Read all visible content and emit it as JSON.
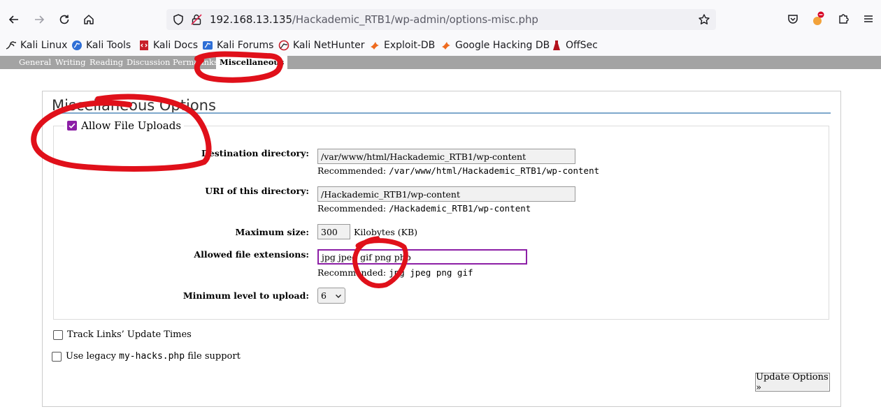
{
  "browser": {
    "url_host": "192.168.13.135",
    "url_path": "/Hackademic_RTB1/wp-admin/options-misc.php",
    "bookmarks": [
      {
        "label": "Kali Linux",
        "icon": "kali-dragon-icon"
      },
      {
        "label": "Kali Tools",
        "icon": "kali-tools-icon"
      },
      {
        "label": "Kali Docs",
        "icon": "kali-docs-icon"
      },
      {
        "label": "Kali Forums",
        "icon": "kali-forums-icon"
      },
      {
        "label": "Kali NetHunter",
        "icon": "nethunter-icon"
      },
      {
        "label": "Exploit-DB",
        "icon": "exploit-db-icon"
      },
      {
        "label": "Google Hacking DB",
        "icon": "ghdb-icon"
      },
      {
        "label": "OffSec",
        "icon": "offsec-icon"
      }
    ]
  },
  "submenu": {
    "items": [
      "General",
      "Writing",
      "Reading",
      "Discussion",
      "Permalinks",
      "Miscellaneous"
    ],
    "current": "Miscellaneous"
  },
  "page": {
    "title": "Miscellaneous Options",
    "allow_uploads_label": "Allow File Uploads",
    "allow_uploads_checked": true,
    "fields": {
      "dest_dir": {
        "label": "Destination directory:",
        "value": "/var/www/html/Hackademic_RTB1/wp-content",
        "rec_prefix": "Recommended:",
        "rec_value": "/var/www/html/Hackademic_RTB1/wp-content"
      },
      "uri_dir": {
        "label": "URI of this directory:",
        "value": "/Hackademic_RTB1/wp-content",
        "rec_prefix": "Recommended:",
        "rec_value": "/Hackademic_RTB1/wp-content"
      },
      "max_size": {
        "label": "Maximum size:",
        "value": "300",
        "unit": "Kilobytes (KB)"
      },
      "extensions": {
        "label": "Allowed file extensions:",
        "value": "jpg jpeg gif png php",
        "rec_prefix": "Recommended:",
        "rec_value": "jpg jpeg png gif"
      },
      "min_level": {
        "label": "Minimum level to upload:",
        "value": "6"
      }
    },
    "track_links_label": "Track Links’ Update Times",
    "legacy_prefix": "Use legacy",
    "legacy_code": "my-hacks.php",
    "legacy_suffix": "file support",
    "submit_label": "Update Options »"
  },
  "colors": {
    "accent": "#8c1fa6",
    "annotation": "#e0101a",
    "submenu_bg": "#a3a3a3"
  }
}
